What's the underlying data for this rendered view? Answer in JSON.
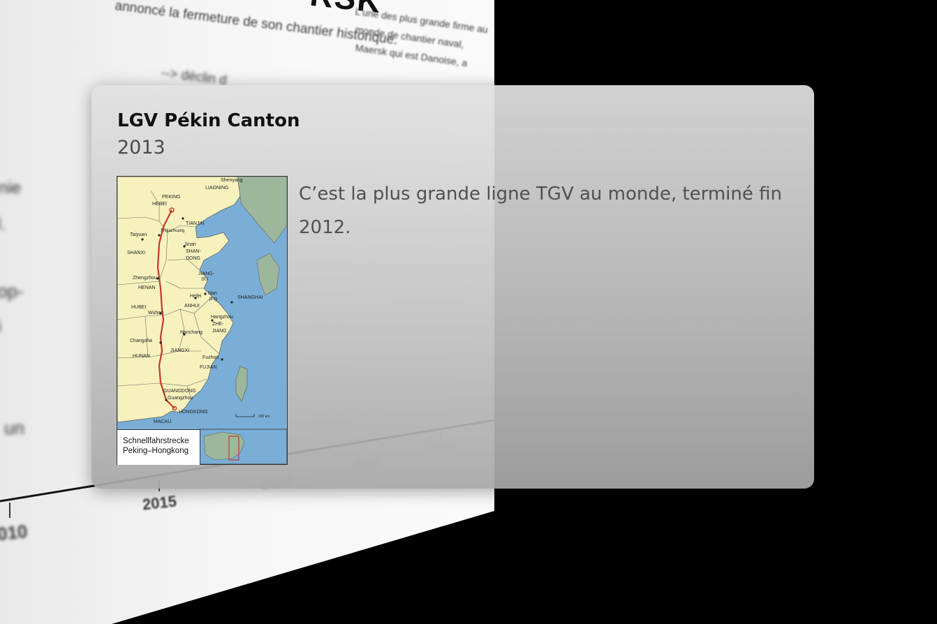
{
  "background": {
    "logo": "RSK",
    "blurb_lines": [
      "L'une des plus grande firme au",
      "monde de chantier naval,",
      "Maersk qui est Danoise, a"
    ],
    "headline": "annoncé la fermeture de son chantier historique.",
    "arrow_text": "--> déclin d",
    "side_fragments": [
      "nie",
      "l.",
      "op-",
      "i",
      "un"
    ],
    "axis_years": [
      "010",
      "2015",
      "2020",
      "2025",
      "2030"
    ]
  },
  "card": {
    "title": "LGV Pékin Canton",
    "year": "2013",
    "description": "C’est la plus grande ligne TGV au monde, terminé fin 2012.",
    "map": {
      "caption_line1": "Schnellfahrstrecke",
      "caption_line2": "Peking–Hongkong",
      "scale": "200 km",
      "labels": {
        "shenyang": "Shenyang",
        "liaoning": "LIAONING",
        "peking": "PEKING",
        "hebei": "HEBEI",
        "tianjin": "TIANJIN",
        "shijiazhuang": "Shijiazhuang",
        "taiyuan": "Taiyuan",
        "shanxi": "SHANXI",
        "jinan": "Jinan",
        "shandong1": "SHAN-",
        "shandong2": "DONG",
        "zhengzhou": "Zhengzhou",
        "henan": "HENAN",
        "jiangsu1": "JIANG-",
        "jiangsu2": "SU",
        "nanjing1": "Nan",
        "nanjing2": "jing",
        "hefei": "Hefei",
        "anhui": "ANHUI",
        "shanghai": "SHANGHAI",
        "hubei": "HUBEI",
        "wuhan": "Wuhan",
        "hangzhou": "Hangzhou",
        "zhejiang1": "ZHE-",
        "zhejiang2": "JIANG",
        "changsha": "Changsha",
        "nanchang": "Nanchang",
        "jiangxi": "JIANGXI",
        "hunan": "HUNAN",
        "fuzhou": "Fuzhou",
        "fujian": "FUJIAN",
        "guangdong": "GUANGDONG",
        "guangzhou": "Guangzhou",
        "hongkong": "HONGKONG",
        "macau": "MACAU"
      }
    }
  },
  "colors": {
    "land": "#f7f2bd",
    "sea": "#7aaed6",
    "foreign": "#9db79c",
    "route": "#c23a2a"
  }
}
